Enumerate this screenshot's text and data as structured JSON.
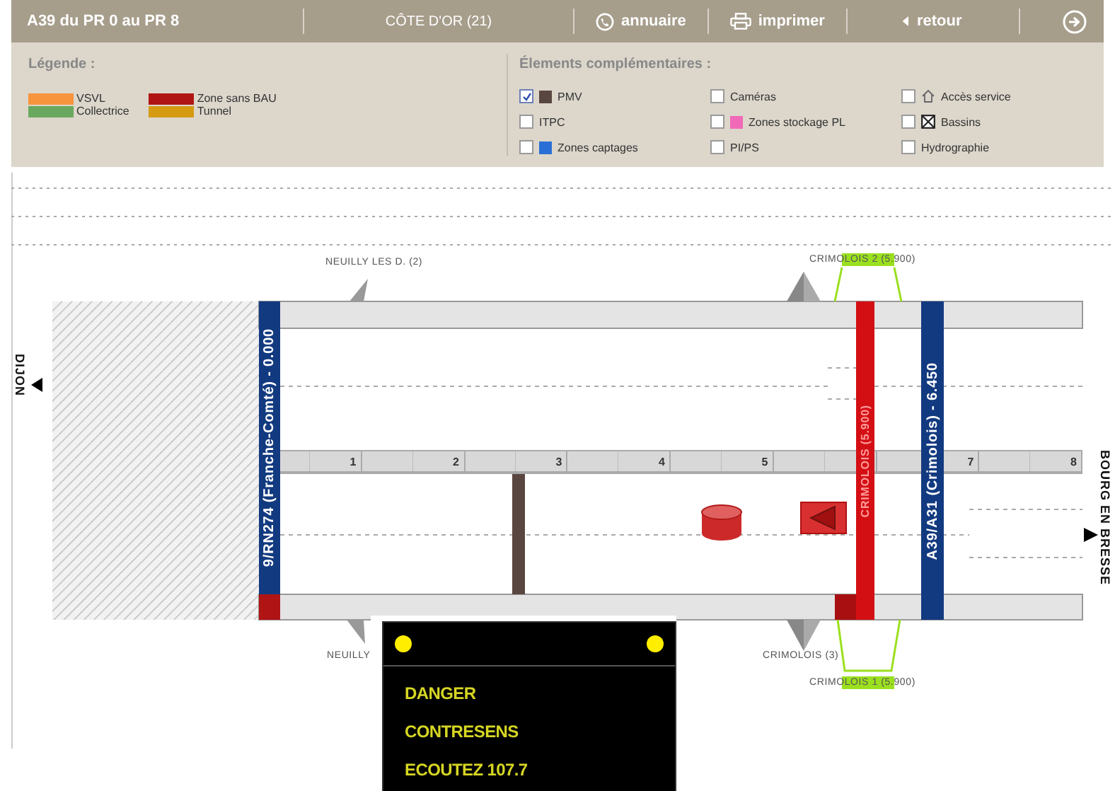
{
  "header": {
    "title": "A39 du PR 0 au PR 8",
    "region": "CÔTE D'OR (21)",
    "links": [
      {
        "label": "annuaire",
        "kind": "phone"
      },
      {
        "label": "imprimer",
        "kind": "printer"
      },
      {
        "label": "retour",
        "kind": "back"
      }
    ]
  },
  "legend": {
    "title": "Légende :",
    "items": [
      {
        "label": "VSVL",
        "color": "#f7943c"
      },
      {
        "label": "Collectrice",
        "color": "#6aa85f"
      },
      {
        "label": "Zone sans BAU",
        "color": "#b01414"
      },
      {
        "label": "Tunnel",
        "color": "#d49a10"
      }
    ]
  },
  "extras": {
    "title": "Élements complémentaires :",
    "items": [
      {
        "label": "PMV",
        "checked": true,
        "kind": "swatch",
        "color": "#5a4640"
      },
      {
        "label": "ITPC",
        "checked": false,
        "kind": "plain"
      },
      {
        "label": "Zones captages",
        "checked": false,
        "kind": "swatch",
        "color": "#2a6fd6"
      },
      {
        "label": "Caméras",
        "checked": false,
        "kind": "plain"
      },
      {
        "label": "Zones stockage PL",
        "checked": false,
        "kind": "swatch",
        "color": "#f06ab8"
      },
      {
        "label": "PI/PS",
        "checked": false,
        "kind": "plain"
      },
      {
        "label": "Accès service",
        "checked": false,
        "kind": "house"
      },
      {
        "label": "Bassins",
        "checked": false,
        "kind": "crossbox"
      },
      {
        "label": "Hydrographie",
        "checked": false,
        "kind": "plain"
      }
    ]
  },
  "diagram": {
    "left_destination": "DIJON",
    "right_destination": "BOURG EN BRESSE",
    "pr_marks": [
      "1",
      "2",
      "3",
      "4",
      "5",
      "7",
      "8"
    ],
    "junctions": [
      {
        "label": "9/RN274 (Franche-Comté) - 0.000",
        "color": "#123a80"
      },
      {
        "label": "CRIMOLOIS (5.900)",
        "color": "#d40f14"
      },
      {
        "label": "A39/A31 (Crimolois) - 6.450",
        "color": "#123a80"
      }
    ],
    "interchanges": [
      "NEUILLY LES D. (2)",
      "CRIMOLOIS 2 (5.900)",
      "NEUILLY",
      "CRIMOLOIS (3)",
      "CRIMOLOIS 1 (5.900)"
    ],
    "sign": {
      "lines": [
        "DANGER",
        "CONTRESENS",
        "ECOUTEZ 107.7"
      ]
    }
  }
}
